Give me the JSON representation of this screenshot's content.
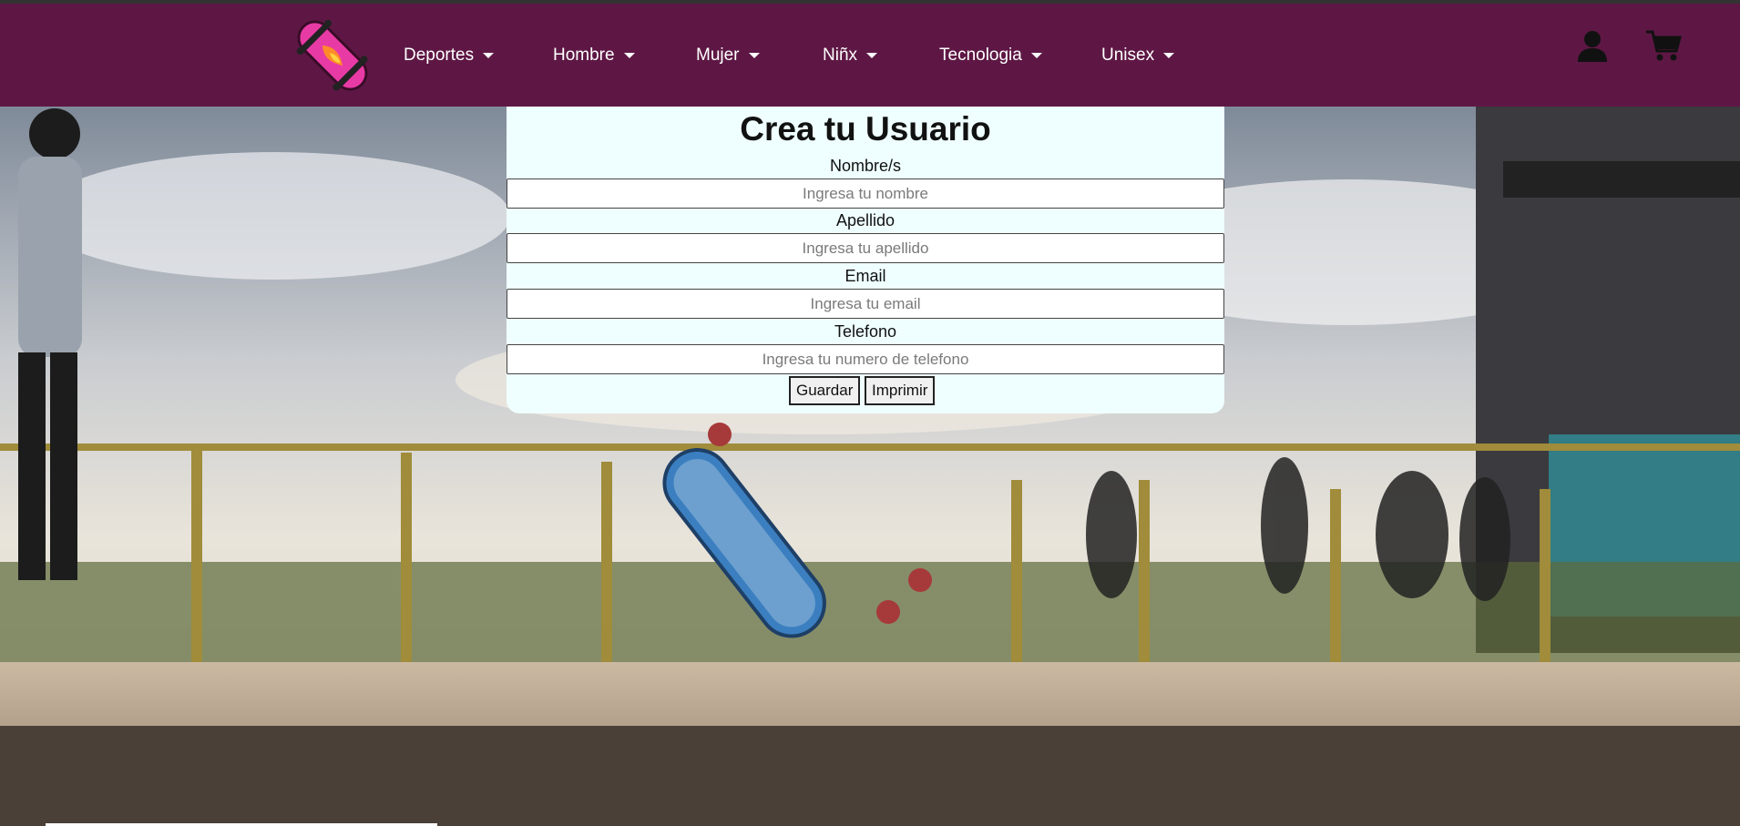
{
  "nav": {
    "items": [
      {
        "label": "Deportes"
      },
      {
        "label": "Hombre"
      },
      {
        "label": "Mujer"
      },
      {
        "label": "Niñx"
      },
      {
        "label": "Tecnologia"
      },
      {
        "label": "Unisex"
      }
    ],
    "icons": {
      "user": "user-icon",
      "cart": "cart-icon",
      "logo": "skateboard-logo"
    }
  },
  "form": {
    "title": "Crea tu Usuario",
    "fields": [
      {
        "label": "Nombre/s",
        "placeholder": "Ingresa tu nombre"
      },
      {
        "label": "Apellido",
        "placeholder": "Ingresa tu apellido"
      },
      {
        "label": "Email",
        "placeholder": "Ingresa tu email"
      },
      {
        "label": "Telefono",
        "placeholder": "Ingresa tu numero de telefono"
      }
    ],
    "buttons": {
      "save": "Guardar",
      "print": "Imprimir"
    }
  },
  "colors": {
    "navbar": "#5e1744",
    "card": "#efffff",
    "logo": "#e83aa5"
  }
}
